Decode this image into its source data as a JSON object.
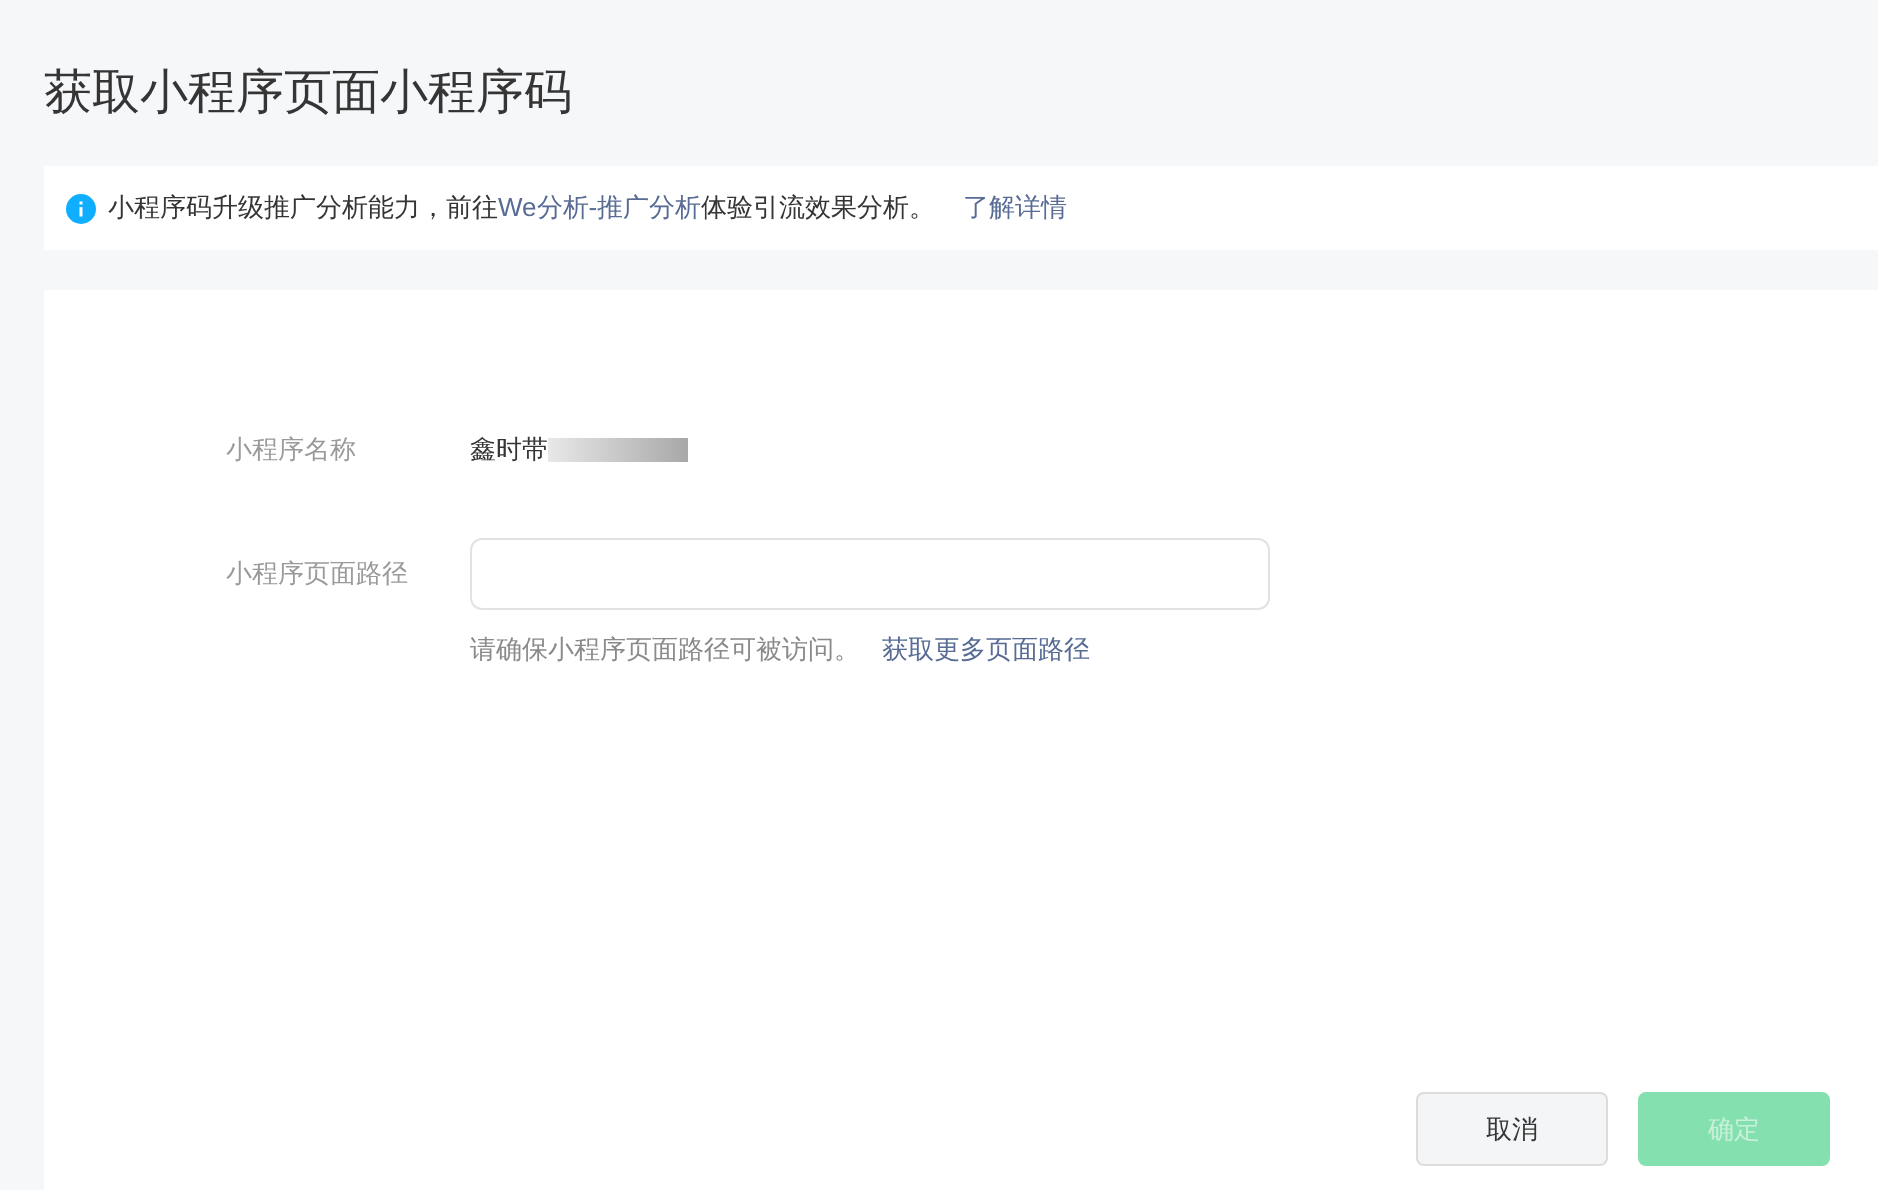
{
  "page": {
    "title": "获取小程序页面小程序码"
  },
  "notice": {
    "text_before": "小程序码升级推广分析能力，前往",
    "link": "We分析-推广分析",
    "text_after": "体验引流效果分析。",
    "more_link": "了解详情"
  },
  "form": {
    "name_label": "小程序名称",
    "name_value": "鑫时带",
    "name_redacted": true,
    "path_label": "小程序页面路径",
    "hint": "请确保小程序页面路径可被访问。",
    "hint_link": "获取更多页面路径"
  },
  "buttons": [
    {
      "label": "取消",
      "kind": "secondary",
      "disabled": false
    },
    {
      "label": "确定",
      "kind": "primary",
      "disabled": true
    }
  ]
}
